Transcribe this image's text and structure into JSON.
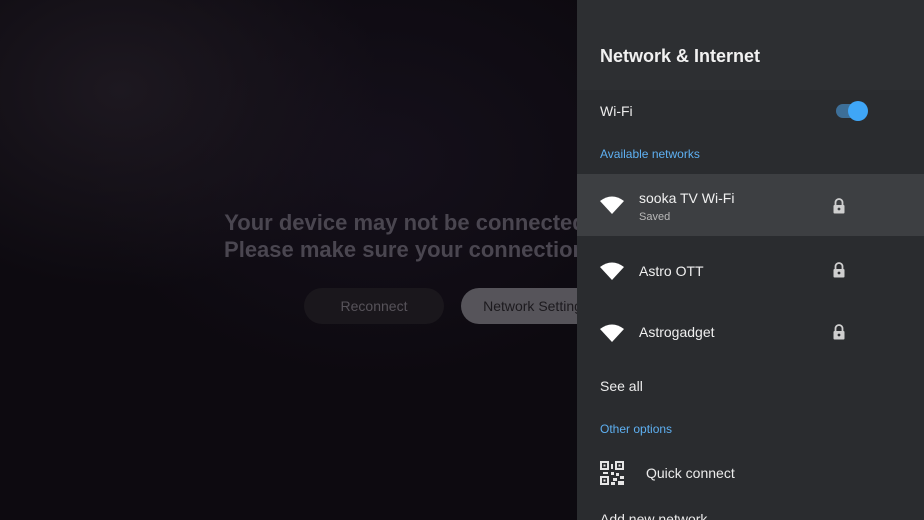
{
  "background": {
    "message_line1": "Your device may not be connected",
    "message_line2": "Please make sure your connection",
    "reconnect_label": "Reconnect",
    "network_settings_label": "Network Settings"
  },
  "panel": {
    "title": "Network & Internet",
    "wifi": {
      "label": "Wi-Fi",
      "enabled": true
    },
    "available_networks_label": "Available networks",
    "networks": [
      {
        "name": "sooka TV Wi-Fi",
        "status": "Saved",
        "secured": true,
        "icon": "wifi-icon"
      },
      {
        "name": "Astro OTT",
        "status": "",
        "secured": true,
        "icon": "wifi-icon"
      },
      {
        "name": "Astrogadget",
        "status": "",
        "secured": true,
        "icon": "wifi-icon"
      }
    ],
    "see_all_label": "See all",
    "other_options_label": "Other options",
    "quick_connect_label": "Quick connect",
    "add_network_label": "Add new network"
  },
  "colors": {
    "accent": "#5eb0f2",
    "toggle_on": "#3fa6f7",
    "panel_bg": "#2a2c2f",
    "selected_row": "#3d3f42"
  }
}
